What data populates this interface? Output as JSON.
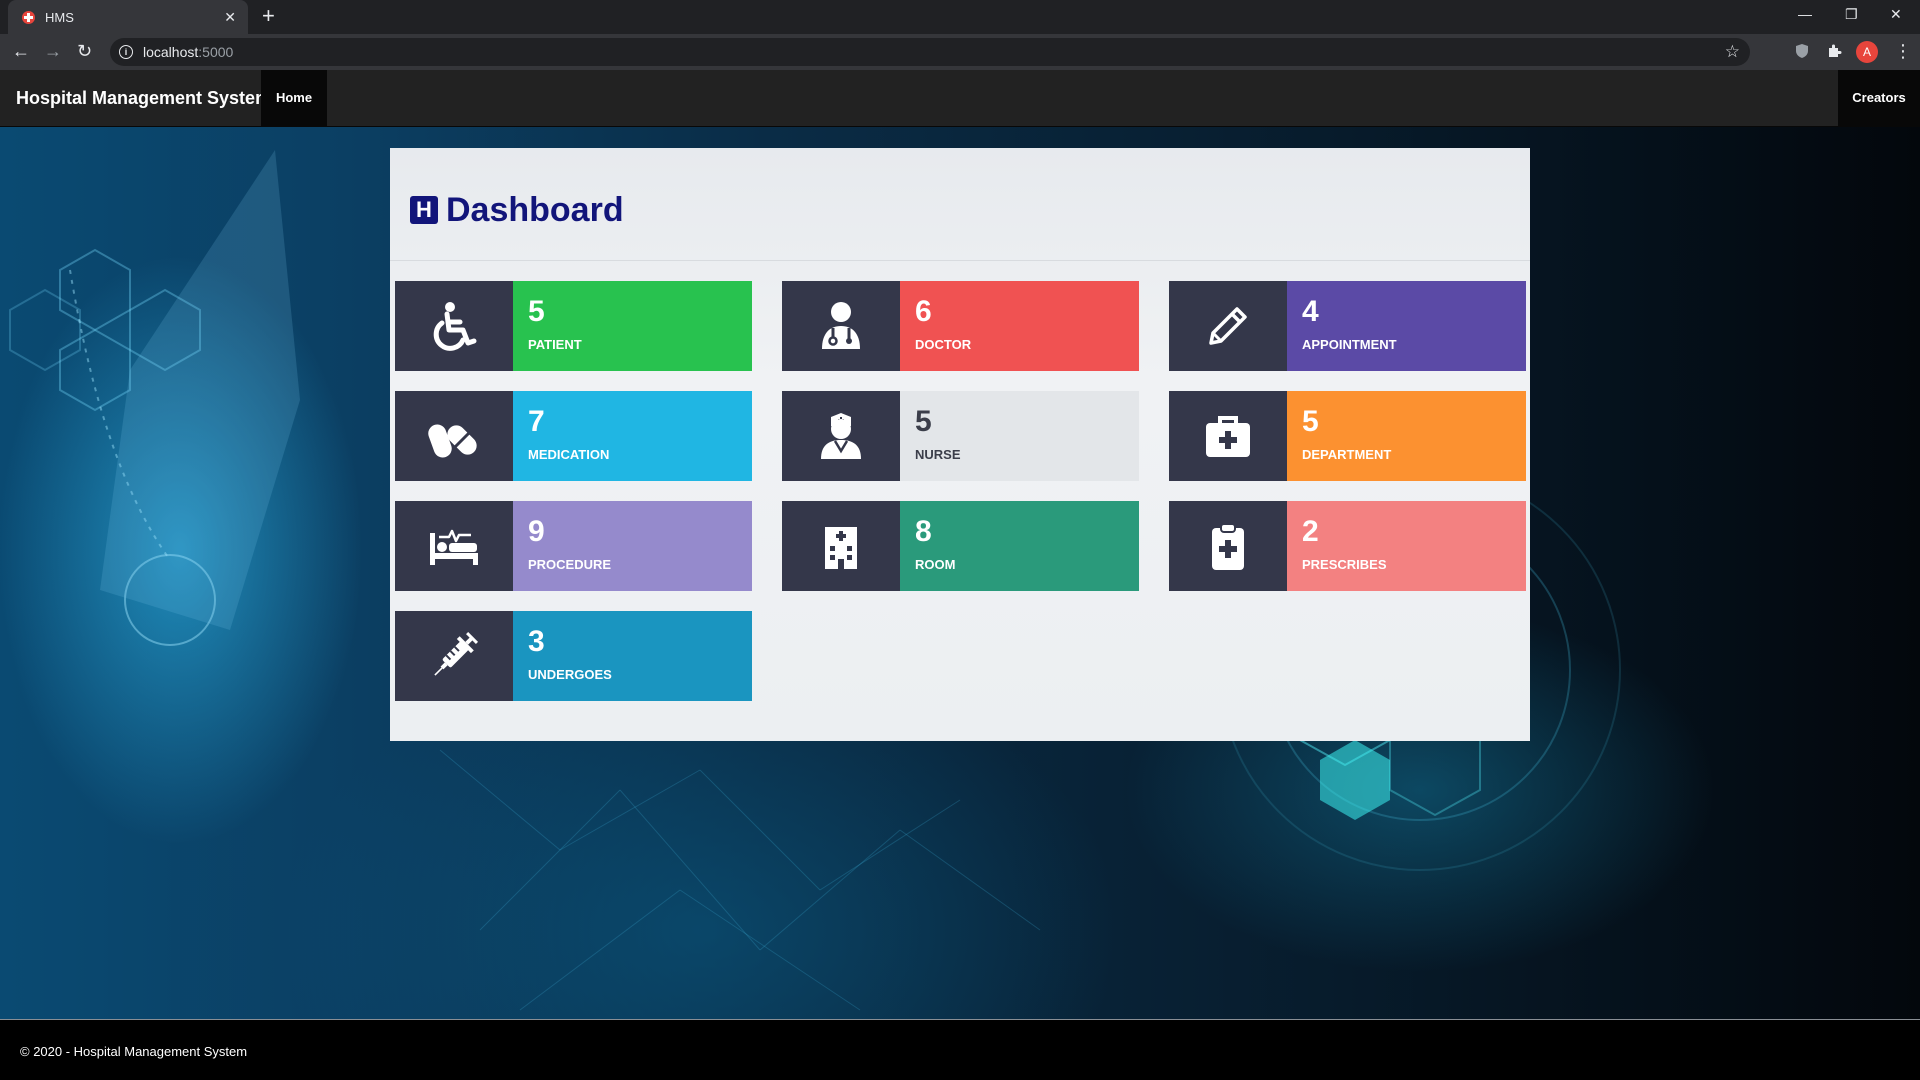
{
  "browser": {
    "tab_title": "HMS",
    "url_host": "localhost",
    "url_port": ":5000",
    "avatar_letter": "A"
  },
  "navbar": {
    "brand": "Hospital Management System",
    "home": "Home",
    "creators": "Creators"
  },
  "dashboard": {
    "title": "Dashboard",
    "logo_letter": "H",
    "cards": [
      {
        "count": "5",
        "label": "PATIENT",
        "icon": "wheelchair-icon",
        "color": "#28c24f",
        "text_color": "#ffffff"
      },
      {
        "count": "6",
        "label": "DOCTOR",
        "icon": "doctor-icon",
        "color": "#f05252",
        "text_color": "#ffffff"
      },
      {
        "count": "4",
        "label": "APPOINTMENT",
        "icon": "pencil-icon",
        "color": "#5b4aa6",
        "text_color": "#ffffff"
      },
      {
        "count": "7",
        "label": "MEDICATION",
        "icon": "pills-icon",
        "color": "#20b6e3",
        "text_color": "#ffffff"
      },
      {
        "count": "5",
        "label": "NURSE",
        "icon": "nurse-icon",
        "color": "#e3e6e9",
        "text_color": "#3b3e4a"
      },
      {
        "count": "5",
        "label": "DEPARTMENT",
        "icon": "medkit-icon",
        "color": "#fc9130",
        "text_color": "#ffffff"
      },
      {
        "count": "9",
        "label": "PROCEDURE",
        "icon": "procedure-bed-icon",
        "color": "#958acc",
        "text_color": "#ffffff"
      },
      {
        "count": "8",
        "label": "ROOM",
        "icon": "hospital-building-icon",
        "color": "#2a9a7b",
        "text_color": "#ffffff"
      },
      {
        "count": "2",
        "label": "PRESCRIBES",
        "icon": "clipboard-medical-icon",
        "color": "#f38181",
        "text_color": "#ffffff"
      },
      {
        "count": "3",
        "label": "UNDERGOES",
        "icon": "syringe-icon",
        "color": "#1a95c0",
        "text_color": "#ffffff"
      }
    ]
  },
  "footer": {
    "text": "© 2020 - Hospital Management System"
  }
}
